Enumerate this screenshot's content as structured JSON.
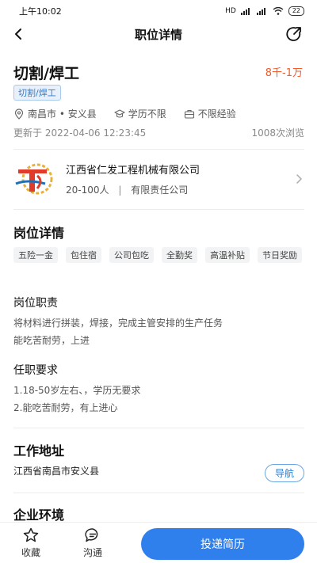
{
  "status_bar": {
    "time": "上午10:02",
    "battery": "22",
    "signal": "HD"
  },
  "nav": {
    "title": "职位详情"
  },
  "job": {
    "title": "切割/焊工",
    "salary": "8千-1万",
    "tag": "切割/焊工",
    "location": "南昌市 • 安义县",
    "education": "学历不限",
    "experience": "不限经验",
    "updated": "更新于 2022-04-06 12:23:45",
    "views": "1008次浏览"
  },
  "company": {
    "name": "江西省仁发工程机械有限公司",
    "size": "20-100人",
    "separator": "|",
    "type": "有限责任公司"
  },
  "details": {
    "title": "岗位详情",
    "benefits": [
      "五险一金",
      "包住宿",
      "公司包吃",
      "全勤奖",
      "高温补贴",
      "节日奖励"
    ],
    "duty_title": "岗位职责",
    "duty_lines": [
      "将材料进行拼装，焊接，完成主管安排的生产任务",
      "能吃苦耐劳，上进"
    ],
    "req_title": "任职要求",
    "req_lines": [
      "1.18-50岁左右、，学历无要求",
      "2.能吃苦耐劳，有上进心"
    ]
  },
  "work_address": {
    "title": "工作地址",
    "address": "江西省南昌市安义县",
    "nav_label": "导航"
  },
  "environment": {
    "title": "企业环境"
  },
  "bottom": {
    "favorite": "收藏",
    "chat": "沟通",
    "apply": "投递简历"
  },
  "colors": {
    "accent": "#2f80ed",
    "salary": "#f25a2b",
    "tag_bg": "#e8f1fb"
  }
}
